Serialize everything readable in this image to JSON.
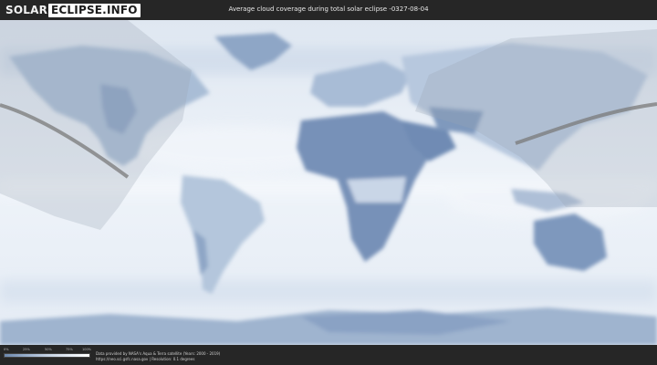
{
  "brand": {
    "part1": "SOLAR",
    "part2": "ECLIPSE.INFO"
  },
  "title": "Average cloud coverage during total solar eclipse -0327-08-04",
  "legend": {
    "ticks": [
      "0%",
      "25%",
      "50%",
      "75%",
      "100%"
    ]
  },
  "credit": {
    "line1": "Data provided by NASA's Aqua & Terra satellite (Years: 2000 - 2019)",
    "line2": "https://neo.sci.gsfc.nasa.gov | Resolution: 0.1 degrees"
  },
  "colors": {
    "land_dark": "#6f8bb4",
    "ocean": "#e6edf6",
    "path": "#7a7a7a"
  }
}
